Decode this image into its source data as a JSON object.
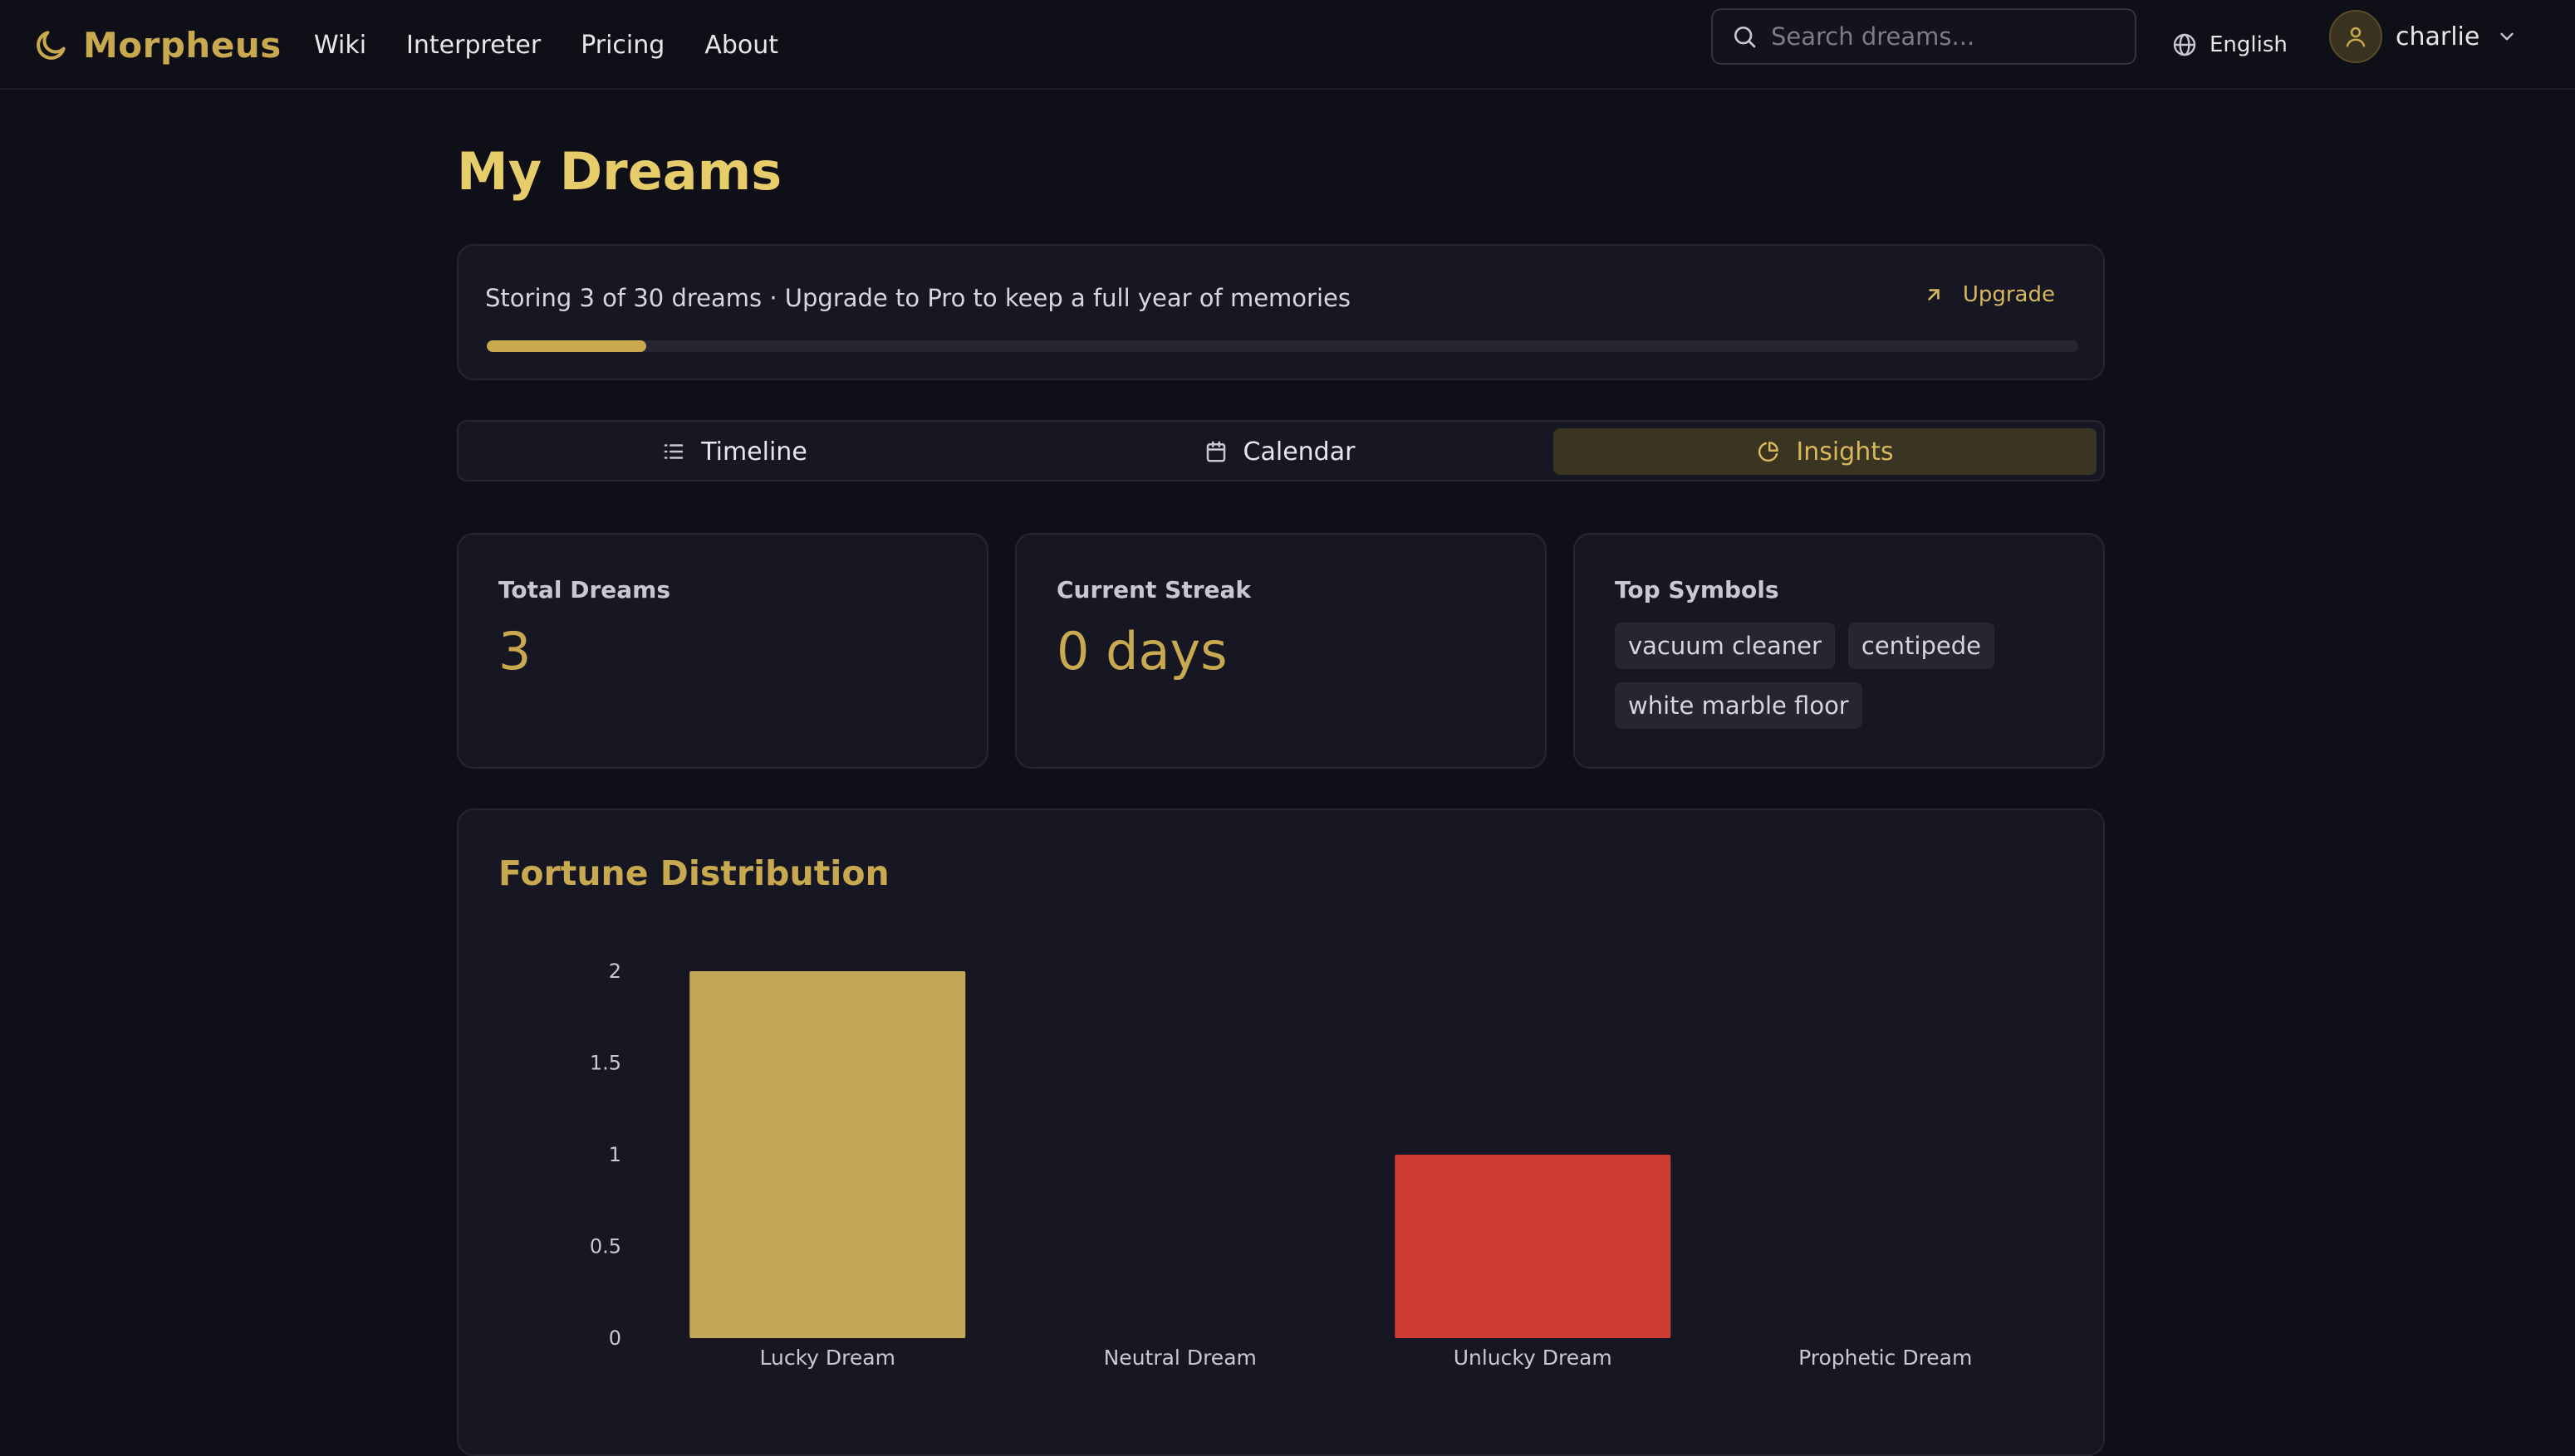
{
  "app": {
    "name": "Morpheus",
    "logo_icon": "moon-icon"
  },
  "nav": {
    "items": [
      {
        "label": "Wiki"
      },
      {
        "label": "Interpreter"
      },
      {
        "label": "Pricing"
      },
      {
        "label": "About"
      }
    ]
  },
  "search": {
    "placeholder": "Search dreams...",
    "value": ""
  },
  "language": {
    "label": "English"
  },
  "user": {
    "name": "charlie"
  },
  "page": {
    "title": "My Dreams"
  },
  "storage": {
    "text": "Storing 3 of 30 dreams · Upgrade to Pro to keep a full year of memories",
    "upgrade_label": "Upgrade",
    "used": 3,
    "limit": 30
  },
  "tabs": [
    {
      "label": "Timeline",
      "icon": "list-icon",
      "active": false
    },
    {
      "label": "Calendar",
      "icon": "calendar-icon",
      "active": false
    },
    {
      "label": "Insights",
      "icon": "pie-chart-icon",
      "active": true
    }
  ],
  "stats": {
    "total": {
      "label": "Total Dreams",
      "value": "3"
    },
    "streak": {
      "label": "Current Streak",
      "value": "0 days"
    },
    "symbols": {
      "label": "Top Symbols",
      "items": [
        "vacuum cleaner",
        "centipede",
        "white marble floor"
      ]
    }
  },
  "colors": {
    "accent": "#c9a94f",
    "lucky": "#c4a85a",
    "unlucky": "#cc3c33",
    "background": "#0f0f18",
    "card": "#171724"
  },
  "chart_data": {
    "type": "bar",
    "title": "Fortune Distribution",
    "categories": [
      "Lucky Dream",
      "Neutral Dream",
      "Unlucky Dream",
      "Prophetic Dream"
    ],
    "values": [
      2,
      0,
      1,
      0
    ],
    "bar_colors": [
      "#c4a85a",
      "#c4a85a",
      "#cc3c33",
      "#c4a85a"
    ],
    "yticks": [
      "0",
      "0.5",
      "1",
      "1.5",
      "2"
    ],
    "ylim": [
      0,
      2
    ],
    "xlabel": "",
    "ylabel": "",
    "grid": false,
    "legend": "none"
  }
}
